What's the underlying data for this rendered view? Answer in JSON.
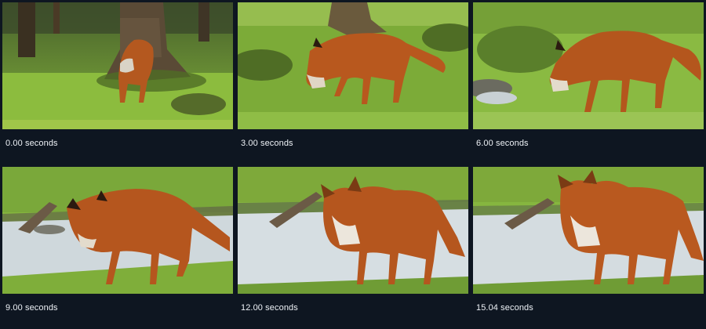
{
  "frames": [
    {
      "timestamp": "0.00 seconds",
      "thumbnail": "fox-frame-forest-tree"
    },
    {
      "timestamp": "3.00 seconds",
      "thumbnail": "fox-frame-grass-sniffing"
    },
    {
      "timestamp": "6.00 seconds",
      "thumbnail": "fox-frame-grass-walking"
    },
    {
      "timestamp": "9.00 seconds",
      "thumbnail": "fox-frame-stream-drinking"
    },
    {
      "timestamp": "12.00 seconds",
      "thumbnail": "fox-frame-stream-looking"
    },
    {
      "timestamp": "15.04 seconds",
      "thumbnail": "fox-frame-stream-standing"
    }
  ],
  "colors": {
    "background": "#0e1621",
    "caption_text": "#eef2f7",
    "grass": "#7fb23a",
    "fox_fur": "#b5561e",
    "water": "#cfd9df"
  }
}
